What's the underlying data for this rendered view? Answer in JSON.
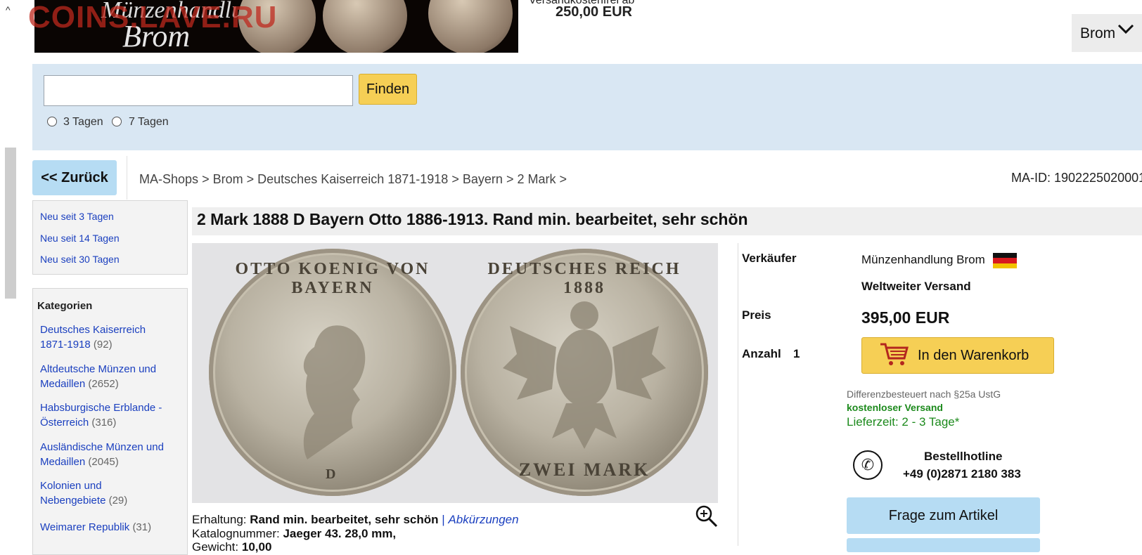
{
  "header": {
    "banner_name": "Münzenhandlung",
    "banner_brom": "Brom",
    "watermark": "COINS.LAVE.RU",
    "ship_from_label": "Versandkostenfrei ab",
    "ship_from_price": "250,00 EUR",
    "account_label": "Brom",
    "account_icon": "chevron-down-icon"
  },
  "search": {
    "value": "",
    "button_label": "Finden",
    "radio_1": "3 Tagen",
    "radio_2": "7 Tagen"
  },
  "nav": {
    "back_label": "<< Zurück",
    "breadcrumbs": [
      "MA-Shops",
      "Brom",
      "Deutsches Kaiserreich 1871-1918",
      "Bayern",
      "2 Mark"
    ],
    "separator": ">",
    "ma_id": "MA-ID: 1902225020001"
  },
  "sidebar": {
    "new_links": [
      "Neu seit 3 Tagen",
      "Neu seit 14 Tagen",
      "Neu seit 30 Tagen"
    ],
    "categories_title": "Kategorien",
    "categories": [
      {
        "line1": "Deutsches Kaiserreich",
        "line2": "1871-1918",
        "count": "(92)"
      },
      {
        "line1": "Altdeutsche Münzen und",
        "line2": "Medaillen",
        "count": "(2652)"
      },
      {
        "line1": "Habsburgische Erblande -",
        "line2": "Österreich",
        "count": "(316)"
      },
      {
        "line1": "Ausländische Münzen und",
        "line2": "Medaillen",
        "count": "(2045)"
      },
      {
        "line1": "Kolonien und",
        "line2": "Nebengebiete",
        "count": "(29)"
      },
      {
        "line1": "Weimarer Republik",
        "line2": "",
        "count": "(31)"
      }
    ]
  },
  "product": {
    "title": "2 Mark 1888 D Bayern Otto 1886-1913. Rand min. bearbeitet, sehr schön",
    "coin_obverse_legend": "OTTO KOENIG VON BAYERN",
    "coin_obverse_mint": "D",
    "coin_reverse_legend": "DEUTSCHES REICH 1888",
    "coin_reverse_value": "ZWEI MARK",
    "zoom_icon": "magnifier-plus-icon",
    "condition_label": "Erhaltung:",
    "condition_value": "Rand min. bearbeitet, sehr schön",
    "condition_sep": "|",
    "abbrev_link": "Abkürzungen",
    "catalog_label": "Katalognummer:",
    "catalog_value": "Jaeger 43. 28,0 mm,",
    "weight_label": "Gewicht:",
    "weight_value": "10,00"
  },
  "purchase": {
    "seller_label": "Verkäufer",
    "seller_name": "Münzenhandlung Brom",
    "shipping_note": "Weltweiter Versand",
    "price_label": "Preis",
    "price_value": "395,00 EUR",
    "qty_label": "Anzahl",
    "qty_value": "1",
    "cart_label": "In den Warenkorb",
    "cart_icon": "shopping-cart-icon",
    "tax_note": "Differenzbesteuert nach §25a UstG",
    "free_shipping": "kostenloser Versand",
    "delivery": "Lieferzeit: 2 - 3 Tage*",
    "hotline_title": "Bestellhotline",
    "hotline_number": "+49 (0)2871 2180 383",
    "ask_label": "Frage zum Artikel"
  },
  "colors": {
    "accent_yellow": "#f6cf55",
    "accent_blue": "#b6dcf3",
    "band_blue": "#d9e7f3",
    "link_blue": "#1a3fbf",
    "green": "#1c8a1c"
  }
}
